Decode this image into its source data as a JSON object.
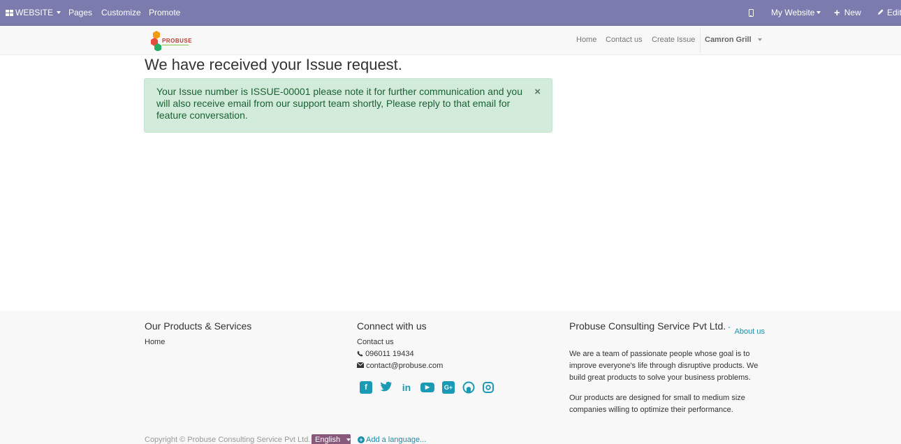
{
  "admin_bar": {
    "website_label": "WEBSITE",
    "pages_label": "Pages",
    "customize_label": "Customize",
    "promote_label": "Promote",
    "my_website_label": "My Website",
    "new_label": "New",
    "edit_label": "Edit",
    "bar_color": "#7c7bad"
  },
  "site_nav": {
    "logo_text": "PROBUSE",
    "links": [
      "Home",
      "Contact us",
      "Create Issue"
    ],
    "user_name": "Camron Grill"
  },
  "main": {
    "title": "We have received your Issue request.",
    "alert_text": "Your Issue number is ISSUE-00001 please note it for further communication and you will also receive email from our support team shortly, Please reply to that email for feature conversation.",
    "alert_close": "×"
  },
  "footer": {
    "products": {
      "title": "Our Products & Services",
      "links": [
        "Home"
      ]
    },
    "connect": {
      "title": "Connect with us",
      "contact_link": "Contact us",
      "phone": "096011 19434",
      "email": "contact@probuse.com",
      "social_icons": [
        "facebook-icon",
        "twitter-icon",
        "linkedin-icon",
        "youtube-icon",
        "google-plus-icon",
        "github-icon",
        "instagram-icon"
      ]
    },
    "about": {
      "title": "Probuse Consulting Service Pvt Ltd.",
      "separator": " - ",
      "about_link": "About us",
      "para1": "We are a team of passionate people whose goal is to improve everyone's life through disruptive products. We build great products to solve your business problems.",
      "para2": "Our products are designed for small to medium size companies willing to optimize their performance."
    },
    "copyright": "Copyright © Probuse Consulting Service Pvt Ltd.",
    "language": "English",
    "add_language": "Add a language..."
  }
}
